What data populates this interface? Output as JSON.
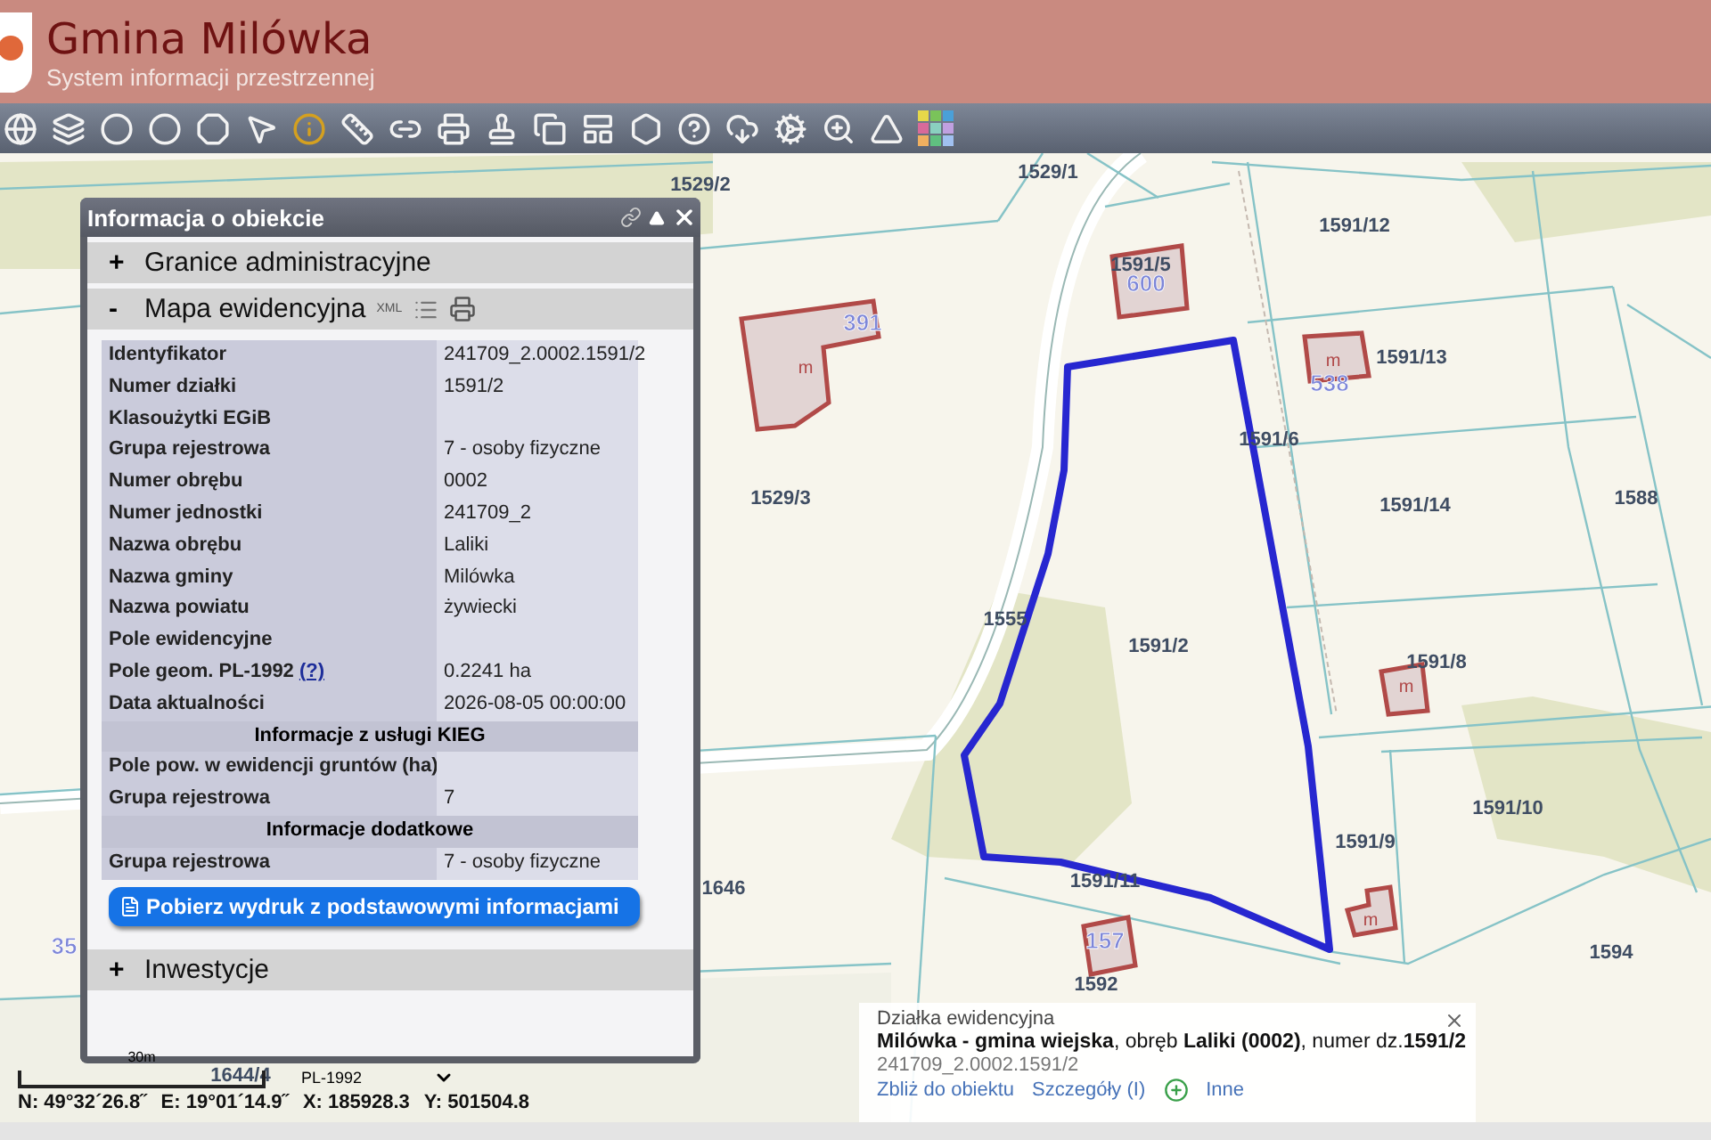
{
  "header": {
    "title": "Gmina Milówka",
    "subtitle": "System informacji przestrzennej"
  },
  "toolbar": {
    "tools": [
      {
        "kind": "globe"
      },
      {
        "kind": "layers"
      },
      {
        "kind": "circle"
      },
      {
        "kind": "circle"
      },
      {
        "kind": "octagon"
      },
      {
        "kind": "pointer"
      },
      {
        "kind": "info"
      },
      {
        "kind": "ruler"
      },
      {
        "kind": "link"
      },
      {
        "kind": "printer"
      },
      {
        "kind": "stamp"
      },
      {
        "kind": "copy"
      },
      {
        "kind": "layout"
      },
      {
        "kind": "shape"
      },
      {
        "kind": "help"
      },
      {
        "kind": "cloud"
      },
      {
        "kind": "gears"
      },
      {
        "kind": "zoom"
      },
      {
        "kind": "triangle"
      },
      {
        "kind": "palette"
      }
    ]
  },
  "map": {
    "parcel_labels": [
      "1529/2",
      "1529/1",
      "1591/5",
      "1591/12",
      "1591/13",
      "1591/6",
      "1529/3",
      "1591/14",
      "1588",
      "1555",
      "1591/2",
      "1591/8",
      "1591/10",
      "1646",
      "1591/9",
      "1591/11",
      "1594",
      "1592",
      "1644/4"
    ],
    "address_points": [
      "600",
      "391",
      "538",
      "157",
      "35"
    ],
    "buildings": [
      "m",
      "m",
      "m",
      "m"
    ]
  },
  "info_panel": {
    "title": "Informacja o obiekcie",
    "sections": [
      {
        "sign": "+",
        "title": "Granice administracyjne",
        "expanded": false
      },
      {
        "sign": "-",
        "title": "Mapa ewidencyjna",
        "expanded": true,
        "format_label": "XML",
        "rows": [
          {
            "kind": "row",
            "label": "Identyfikator",
            "value": "241709_2.0002.1591/2"
          },
          {
            "kind": "row",
            "label": "Numer działki",
            "value": "1591/2"
          },
          {
            "kind": "row",
            "label": "Klasoużytki EGiB"
          },
          {
            "kind": "row",
            "label": "Grupa rejestrowa",
            "value": "7 - osoby fizyczne"
          },
          {
            "kind": "row",
            "label": "Numer obrębu",
            "value": "0002"
          },
          {
            "kind": "row",
            "label": "Numer jednostki",
            "value": "241709_2"
          },
          {
            "kind": "row",
            "label": "Nazwa obrębu",
            "value": "Laliki"
          },
          {
            "kind": "row",
            "label": "Nazwa gminy",
            "value": "Milówka"
          },
          {
            "kind": "row",
            "label": "Nazwa powiatu",
            "value": "żywiecki"
          },
          {
            "kind": "row",
            "label": "Pole ewidencyjne"
          },
          {
            "kind": "row",
            "label": "Pole geom. PL-1992",
            "help": "(?)",
            "value": "0.2241 ha"
          },
          {
            "kind": "row",
            "label": "Data aktualności",
            "value": "2026-08-05 00:00:00"
          },
          {
            "kind": "heading",
            "label": "Informacje z usługi KIEG"
          },
          {
            "kind": "row",
            "label": "Pole pow. w ewidencji gruntów (ha)"
          },
          {
            "kind": "row",
            "label": "Grupa rejestrowa",
            "value": "7"
          },
          {
            "kind": "heading",
            "label": "Informacje dodatkowe"
          },
          {
            "kind": "row",
            "label": "Grupa rejestrowa",
            "value": "7 - osoby fizyczne"
          }
        ],
        "button": "Pobierz wydruk z podstawowymi informacjami"
      },
      {
        "sign": "+",
        "title": "Inwestycje",
        "expanded": false
      }
    ]
  },
  "scale": {
    "label": "30m",
    "projection": "PL-1992",
    "coords": [
      "N: 49°32´26.8˝",
      "E: 19°01´14.9˝",
      "X: 185928.3",
      "Y: 501504.8"
    ]
  },
  "popup": {
    "type": "Działka ewidencyjna",
    "description": "**Milówka - gmina wiejska**, obręb **Laliki (0002)**, numer dz.**1591/2**",
    "id": "241709_2.0002.1591/2",
    "links": [
      "Zbliż do obiektu",
      "Szczegóły (I)",
      "Inne"
    ]
  }
}
